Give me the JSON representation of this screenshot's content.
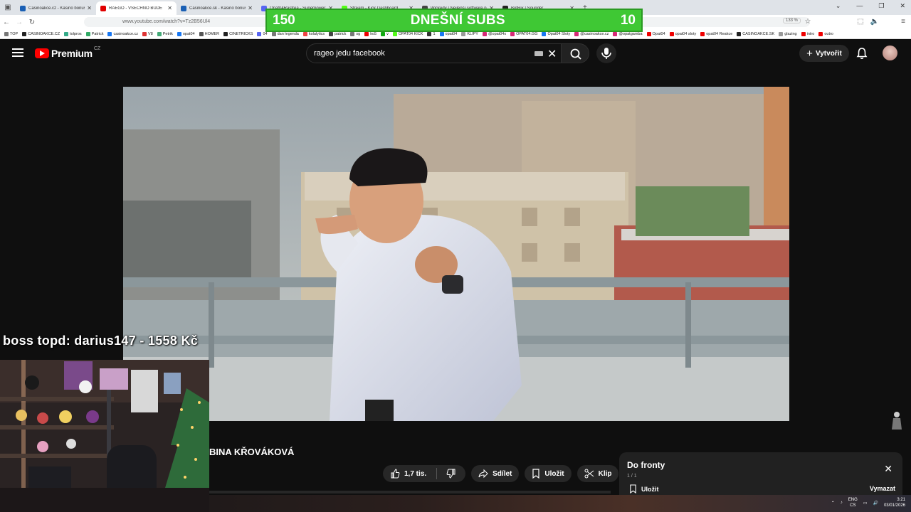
{
  "browser": {
    "tabs": [
      {
        "title": "Casinoakce.cz - Kasino bonusy",
        "color": "#1a5fb4"
      },
      {
        "title": "RAEGO - VŠECHNO BUDE",
        "color": "#e00000",
        "active": true
      },
      {
        "title": "Casinoakce.sk - Kasino bonusy",
        "color": "#1a5fb4"
      },
      {
        "title": "Opat04Rastrea - Superpower Stu",
        "color": "#5865f2"
      },
      {
        "title": "Stream - Kick Dashboard",
        "color": "#53fc18"
      },
      {
        "title": "Wickedy | Nejlepší software pro",
        "color": "#444"
      },
      {
        "title": "BotRix | Sounder",
        "color": "#222"
      }
    ],
    "new_tab": "+",
    "url": "www.youtube.com/watch?v=Tz2B56Ul4",
    "zoom": "133 %",
    "bookmarks": [
      {
        "label": "TOP",
        "color": "#777"
      },
      {
        "label": "CASINOAKCE.CZ",
        "color": "#222"
      },
      {
        "label": "tolpros",
        "color": "#3a8"
      },
      {
        "label": "Patrick",
        "color": "#3a6"
      },
      {
        "label": "casinoakce.cz",
        "color": "#1877f2"
      },
      {
        "label": "V8",
        "color": "#d33"
      },
      {
        "label": "Petrik",
        "color": "#4a7"
      },
      {
        "label": "opat04",
        "color": "#1877f2"
      },
      {
        "label": "HOMER",
        "color": "#555"
      },
      {
        "label": "CINETRICKS",
        "color": "#222"
      },
      {
        "label": "04",
        "color": "#5865f2"
      },
      {
        "label": "dan legenda",
        "color": "#777"
      },
      {
        "label": "kolalytics",
        "color": "#e44"
      },
      {
        "label": "patrick",
        "color": "#444"
      },
      {
        "label": "sg",
        "color": "#777"
      },
      {
        "label": "ko5",
        "color": "#e00"
      },
      {
        "label": "v",
        "color": "#1a1"
      },
      {
        "label": "OPAT04 KICK",
        "color": "#53fc18"
      },
      {
        "label": "1",
        "color": "#333"
      },
      {
        "label": "opat04",
        "color": "#1877f2"
      },
      {
        "label": "KLIPY",
        "color": "#999"
      },
      {
        "label": "@opat04x",
        "color": "#d62976"
      },
      {
        "label": "OPAT04.GG",
        "color": "#d62976"
      },
      {
        "label": "Opat04 Sloty",
        "color": "#1877f2"
      },
      {
        "label": "@casinoakce.cz",
        "color": "#d62976"
      },
      {
        "label": "@opatgamba",
        "color": "#d62976"
      },
      {
        "label": "Opat04",
        "color": "#e00"
      },
      {
        "label": "opat04 sloty",
        "color": "#e00"
      },
      {
        "label": "opat04 Reakce",
        "color": "#e00"
      },
      {
        "label": "CASINOAKCE.SK",
        "color": "#222"
      },
      {
        "label": "glazing",
        "color": "#999"
      },
      {
        "label": "intro",
        "color": "#e00"
      },
      {
        "label": "outro",
        "color": "#e00"
      }
    ]
  },
  "subs_overlay": {
    "left": "150",
    "title": "DNEŠNÍ SUBS",
    "right": "10",
    "color": "#3fc834"
  },
  "youtube": {
    "logo_text": "Premium",
    "logo_country": "CZ",
    "search_query": "rageo jedu facebook",
    "create_label": "Vytvořit",
    "video_title_fragment": "BINA KŘOVÁKOVÁ",
    "actions": {
      "like": "1,7 tis.",
      "share": "Sdílet",
      "save": "Uložit",
      "clip": "Klip"
    },
    "queue": {
      "title": "Do fronty",
      "count": "1 / 1",
      "save": "Uložit",
      "clear": "Vymazat"
    }
  },
  "overlay_text": "boss topd:  darius147 - 1558 Kč",
  "taskbar": {
    "lang_top": "ENG",
    "lang_bottom": "CS",
    "time": "3:21",
    "date": "03/01/2026"
  }
}
